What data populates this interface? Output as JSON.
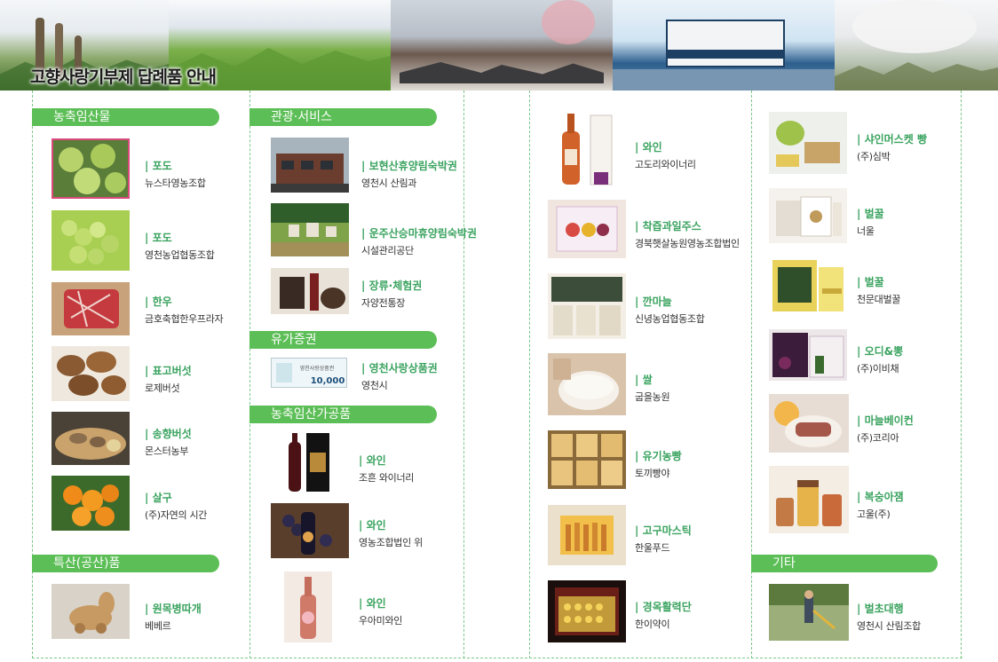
{
  "banner": {
    "title": "고향사랑기부제 답례품 안내"
  },
  "colors": {
    "accent": "#5cbe56",
    "item_name": "#3aa35f",
    "divider": "#7cc68a"
  },
  "sections": {
    "agri": "농축임산물",
    "crafts": "특산(공산)품",
    "tourism": "관광·서비스",
    "securities": "유가증권",
    "processed": "농축임산가공품",
    "other": "기타"
  },
  "col1": [
    {
      "name": "포도",
      "maker": "뉴스타영농조합",
      "icon": "grape-box-photo"
    },
    {
      "name": "포도",
      "maker": "영천농업협동조합",
      "icon": "grapes-photo"
    },
    {
      "name": "한우",
      "maker": "금호축협한우프라자",
      "icon": "beef-photo"
    },
    {
      "name": "표고버섯",
      "maker": "로제버섯",
      "icon": "shiitake-photo"
    },
    {
      "name": "송향버섯",
      "maker": "몬스터농부",
      "icon": "mushroom-plate-photo"
    },
    {
      "name": "살구",
      "maker": "(주)자연의 시간",
      "icon": "apricot-photo"
    }
  ],
  "crafts_items": [
    {
      "name": "원목병따개",
      "maker": "베베르",
      "icon": "wooden-opener-photo"
    }
  ],
  "col2_tourism": [
    {
      "name": "보현산휴양림숙박권",
      "maker": "영천시 산림과",
      "icon": "lodge-photo"
    },
    {
      "name": "운주산승마휴양림숙박권",
      "maker": "시설관리공단",
      "icon": "forest-resort-photo"
    },
    {
      "name": "장류·체험권",
      "maker": "자양전통장",
      "icon": "jang-photo"
    }
  ],
  "col2_securities": [
    {
      "name": "영천사랑상품권",
      "maker": "영천시",
      "voucher_text": "영천사랑상품권",
      "voucher_amount": "10,000",
      "icon": "voucher-photo"
    }
  ],
  "col2_processed": [
    {
      "name": "와인",
      "maker": "조흔 와이너리",
      "icon": "wine-box-photo"
    },
    {
      "name": "와인",
      "maker": "영농조합법인 위",
      "icon": "wine-grapes-photo"
    },
    {
      "name": "와인",
      "maker": "우아미와인",
      "icon": "rose-wine-photo"
    }
  ],
  "col3": [
    {
      "name": "와인",
      "maker": "고도리와이너리",
      "icon": "wine-bottle-photo"
    },
    {
      "name": "착즙과일주스",
      "maker": "경북햇살농원영농조합법인",
      "icon": "juice-box-photo"
    },
    {
      "name": "깐마늘",
      "maker": "신녕농업협동조합",
      "icon": "garlic-photo"
    },
    {
      "name": "쌀",
      "maker": "굽을농원",
      "icon": "rice-photo"
    },
    {
      "name": "유기농빵",
      "maker": "토끼빵야",
      "icon": "bread-photo"
    },
    {
      "name": "고구마스틱",
      "maker": "한울푸드",
      "icon": "sweet-potato-photo"
    },
    {
      "name": "경옥활력단",
      "maker": "한이약이",
      "icon": "pill-box-photo"
    }
  ],
  "col4": [
    {
      "name": "샤인머스켓 빵",
      "maker": "(주)심박",
      "icon": "grape-bread-photo"
    },
    {
      "name": "벌꿀",
      "maker": "너울",
      "icon": "honey-gift-photo"
    },
    {
      "name": "벌꿀",
      "maker": "천문대벌꿀",
      "icon": "honey-box-photo"
    },
    {
      "name": "오디&뽕",
      "maker": "(주)이비채",
      "icon": "mulberry-photo"
    },
    {
      "name": "마늘베이컨",
      "maker": "(주)코리아",
      "icon": "bacon-photo"
    },
    {
      "name": "복숭아잼",
      "maker": "고울(주)",
      "icon": "jam-photo"
    }
  ],
  "other_items": [
    {
      "name": "벌초대행",
      "maker": "영천시 산림조합",
      "icon": "mowing-photo"
    }
  ]
}
